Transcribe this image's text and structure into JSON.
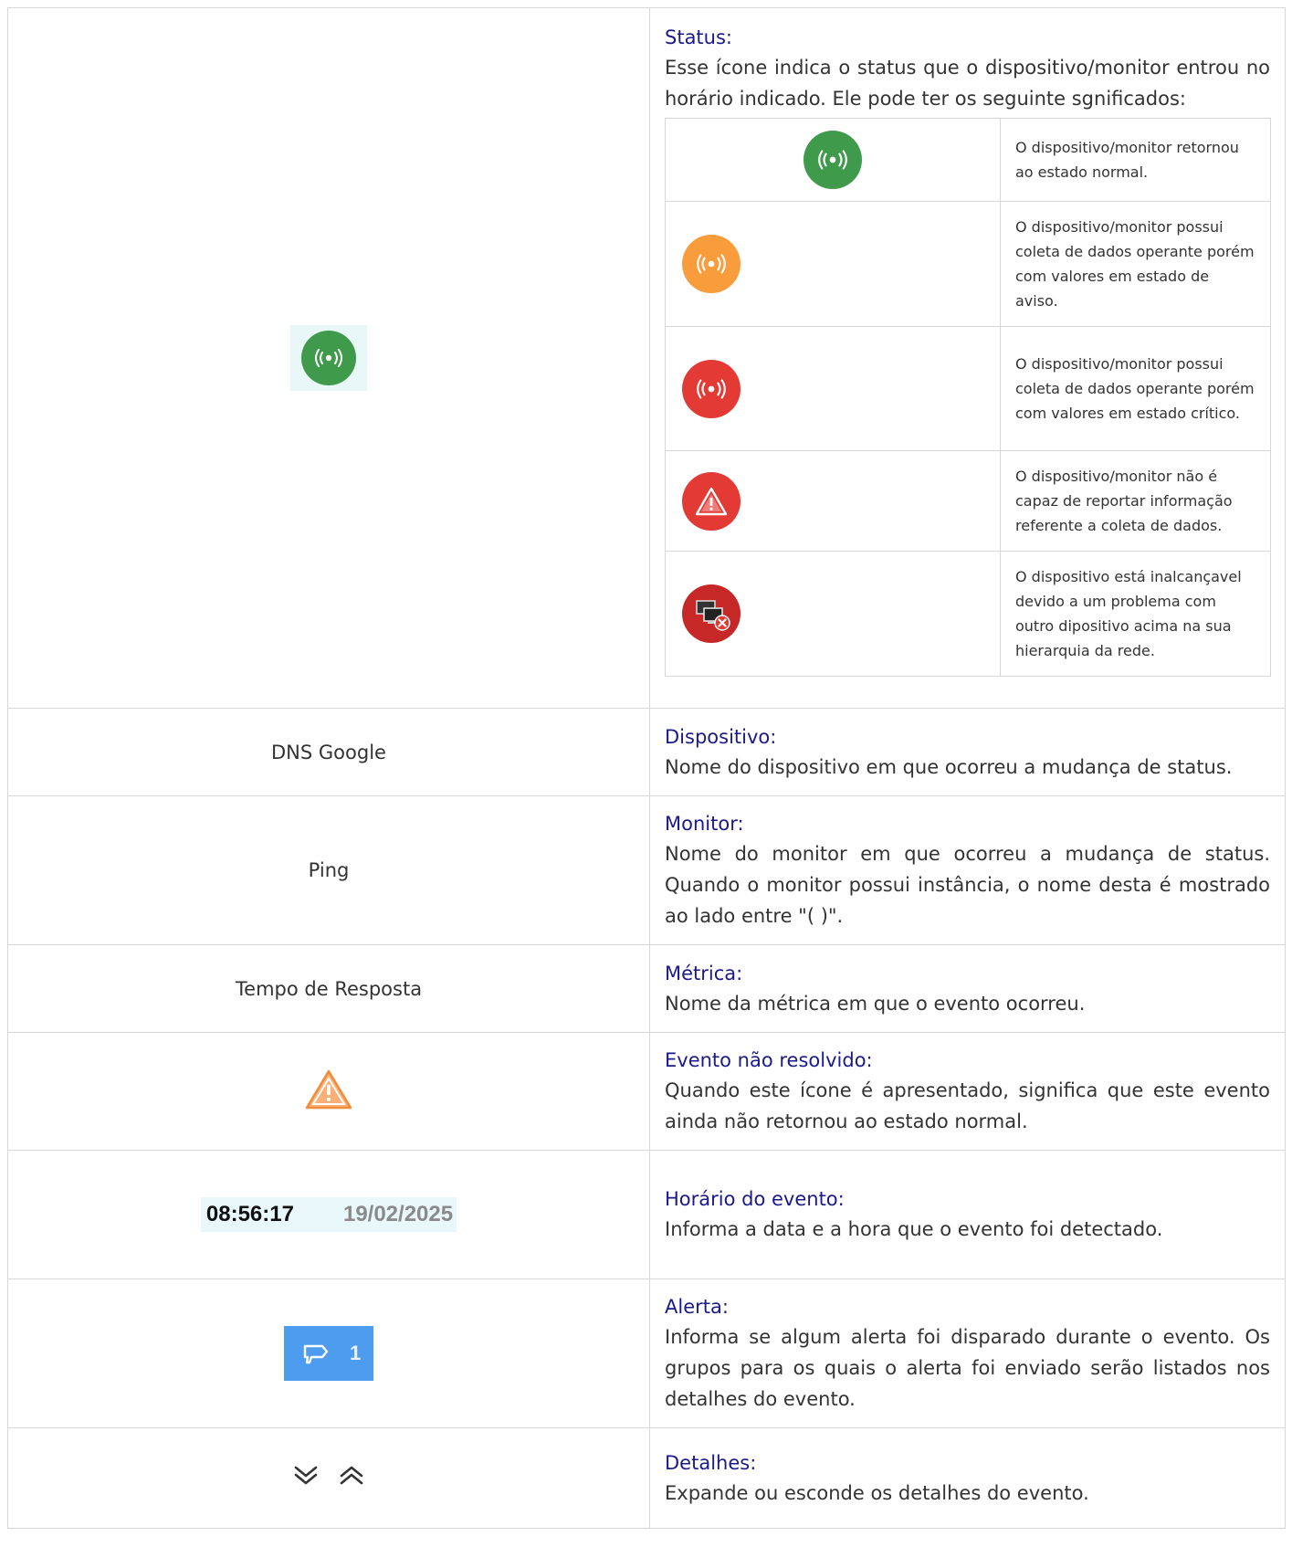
{
  "status": {
    "label": "Status:",
    "description": "Esse ícone indica o status que o dispositivo/monitor entrou no horário indicado. Ele pode ter os seguinte sgnificados:",
    "icon": "signal-green-icon",
    "meanings": [
      {
        "icon": "signal-green-icon",
        "color": "#3f9a4c",
        "text": "O dispositivo/monitor retornou ao estado normal."
      },
      {
        "icon": "signal-orange-icon",
        "color": "#f99d3c",
        "text": "O dispositivo/monitor possui coleta de dados operante porém com valores em estado de aviso."
      },
      {
        "icon": "signal-red-icon",
        "color": "#e33a36",
        "text": "O dispositivo/monitor possui coleta de dados operante porém com valores em estado crítico."
      },
      {
        "icon": "warning-red-icon",
        "color": "#e33a36",
        "text": "O dispositivo/monitor não é capaz de reportar informação referente a coleta de dados."
      },
      {
        "icon": "unreachable-network-icon",
        "color": "#c62828",
        "text": "O dispositivo está inalcançavel devido a um problema com outro dipositivo acima na sua hierarquia da rede."
      }
    ]
  },
  "rows": {
    "device": {
      "example": "DNS Google",
      "label": "Dispositivo:",
      "description": "Nome do dispositivo em que ocorreu a mudança de status."
    },
    "monitor": {
      "example": "Ping",
      "label": "Monitor:",
      "description": "Nome do monitor em que ocorreu a mudança de status. Quando o monitor possui instância, o nome desta é mostrado ao lado entre \"( )\"."
    },
    "metric": {
      "example": "Tempo de Resposta",
      "label": "Métrica:",
      "description": "Nome da métrica em que o evento ocorreu."
    },
    "unresolved": {
      "icon": "warning-orange-icon",
      "label": "Evento não resolvido:",
      "description": "Quando este ícone é apresentado, significa que este evento ainda não retornou ao estado normal."
    },
    "time": {
      "time": "08:56:17",
      "date": "19/02/2025",
      "label": "Horário do evento:",
      "description": "Informa a data e a hora que o evento foi detectado."
    },
    "alert": {
      "icon": "megaphone-icon",
      "count": "1",
      "color": "#4e9cf0",
      "label": "Alerta:",
      "description": "Informa se algum alerta foi disparado durante o evento. Os grupos para os quais o alerta foi enviado serão listados nos detalhes do evento."
    },
    "details": {
      "icons": [
        "chevrons-down-icon",
        "chevrons-up-icon"
      ],
      "label": "Detalhes:",
      "description": "Expande ou esconde os detalhes do evento."
    }
  }
}
